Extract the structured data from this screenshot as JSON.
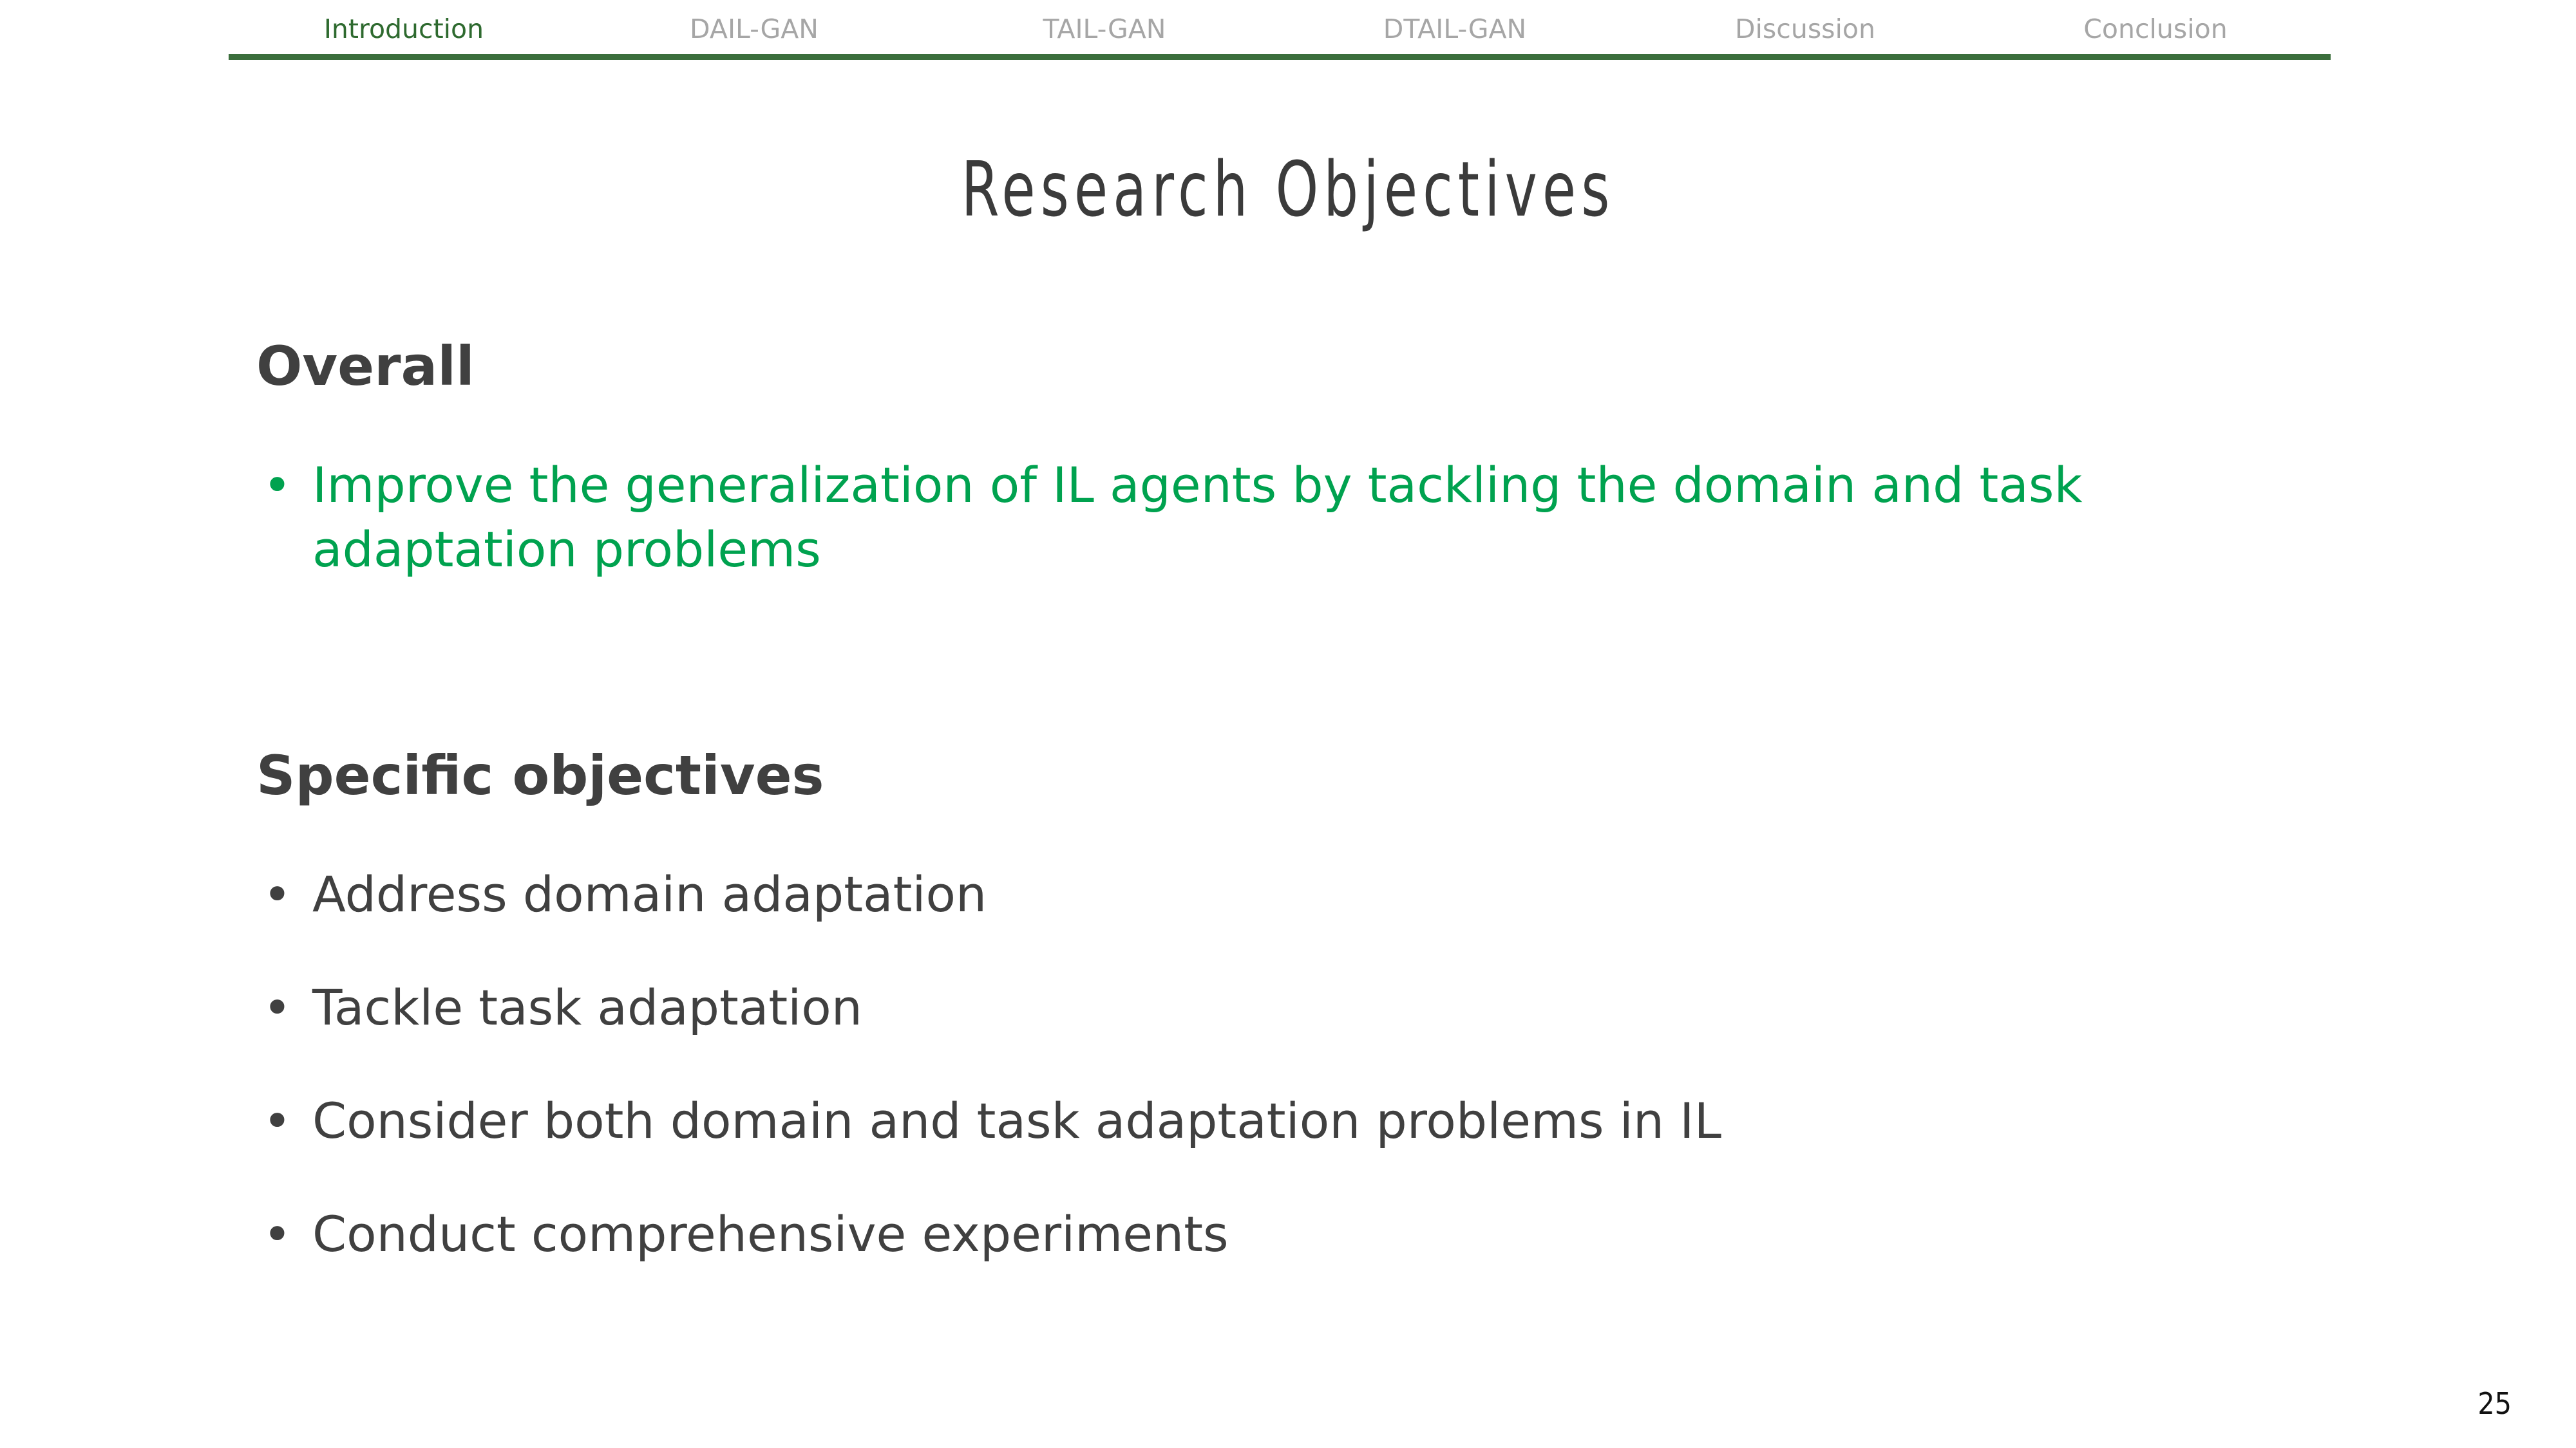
{
  "nav": {
    "tabs": [
      {
        "label": "Introduction"
      },
      {
        "label": "DAIL-GAN"
      },
      {
        "label": "TAIL-GAN"
      },
      {
        "label": "DTAIL-GAN"
      },
      {
        "label": "Discussion"
      },
      {
        "label": "Conclusion"
      }
    ],
    "active_tab": "Introduction",
    "active_color": "#2e6a2f",
    "inactive_color": "#a6a6a6",
    "rule_color": "#3b6e3c"
  },
  "slide": {
    "title": "Research Objectives",
    "overall": {
      "heading": "Overall",
      "bullets": [
        "Improve the generalization of IL agents by tackling the domain and task adaptation problems"
      ],
      "highlight_color": "#00a24f"
    },
    "specific": {
      "heading": "Specific objectives",
      "bullets": [
        "Address domain adaptation",
        "Tackle task adaptation",
        "Consider both domain and task adaptation problems in IL",
        "Conduct comprehensive experiments"
      ]
    },
    "bullet_glyph": "•",
    "page_number": "25"
  }
}
